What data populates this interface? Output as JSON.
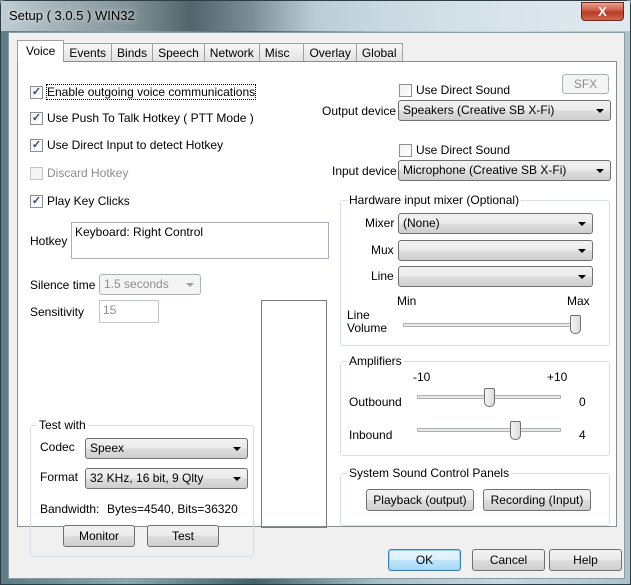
{
  "window": {
    "title": "Setup ( 3.0.5 ) WIN32",
    "close_glyph": "X"
  },
  "tabs": [
    {
      "label": "Voice",
      "active": true
    },
    {
      "label": "Events"
    },
    {
      "label": "Binds"
    },
    {
      "label": "Speech"
    },
    {
      "label": "Network"
    },
    {
      "label": "Misc"
    },
    {
      "label": "Overlay"
    },
    {
      "label": "Global"
    }
  ],
  "voice": {
    "checkboxes": {
      "enable_outgoing": {
        "label": "Enable outgoing voice communications",
        "checked": true
      },
      "push_to_talk": {
        "label": "Use Push To Talk Hotkey ( PTT Mode )",
        "checked": true
      },
      "direct_input": {
        "label": "Use Direct Input to detect Hotkey",
        "checked": true
      },
      "discard_hotkey": {
        "label": "Discard Hotkey",
        "checked": false,
        "disabled": true
      },
      "key_clicks": {
        "label": "Play Key Clicks",
        "checked": true
      }
    },
    "check_glyph": "✓",
    "hotkey": {
      "label": "Hotkey",
      "value": "Keyboard: Right Control"
    },
    "silence_time": {
      "label": "Silence time",
      "value": "1.5 seconds"
    },
    "sensitivity": {
      "label": "Sensitivity",
      "value": "15"
    },
    "test_with": {
      "title": "Test with",
      "codec_label": "Codec",
      "codec_value": "Speex",
      "format_label": "Format",
      "format_value": "32 KHz, 16 bit, 9 Qlty",
      "bandwidth_label": "Bandwidth:",
      "bandwidth_value": "Bytes=4540, Bits=36320",
      "monitor_button": "Monitor",
      "test_button": "Test"
    },
    "output": {
      "direct_sound_label": "Use Direct Sound",
      "direct_sound_checked": false,
      "sfx_button": "SFX",
      "device_label": "Output device",
      "device_value": "Speakers (Creative SB X-Fi)"
    },
    "input": {
      "direct_sound_label": "Use Direct Sound",
      "direct_sound_checked": false,
      "device_label": "Input device",
      "device_value": "Microphone (Creative SB X-Fi)"
    },
    "hardware_mixer": {
      "title": "Hardware input mixer (Optional)",
      "mixer_label": "Mixer",
      "mixer_value": "(None)",
      "mux_label": "Mux",
      "mux_value": "",
      "line_label": "Line",
      "line_value": "",
      "min_label": "Min",
      "max_label": "Max",
      "line_volume_label_1": "Line",
      "line_volume_label_2": "Volume",
      "line_volume_fraction": 1.0
    },
    "amplifiers": {
      "title": "Amplifiers",
      "min_label": "-10",
      "max_label": "+10",
      "min": -10,
      "max": 10,
      "outbound_label": "Outbound",
      "outbound_value": "0",
      "outbound": 0,
      "inbound_label": "Inbound",
      "inbound_value": "4",
      "inbound": 4
    },
    "system_sound": {
      "title": "System Sound Control Panels",
      "playback_button": "Playback (output)",
      "recording_button": "Recording (Input)"
    }
  },
  "footer": {
    "ok": "OK",
    "cancel": "Cancel",
    "help": "Help"
  }
}
